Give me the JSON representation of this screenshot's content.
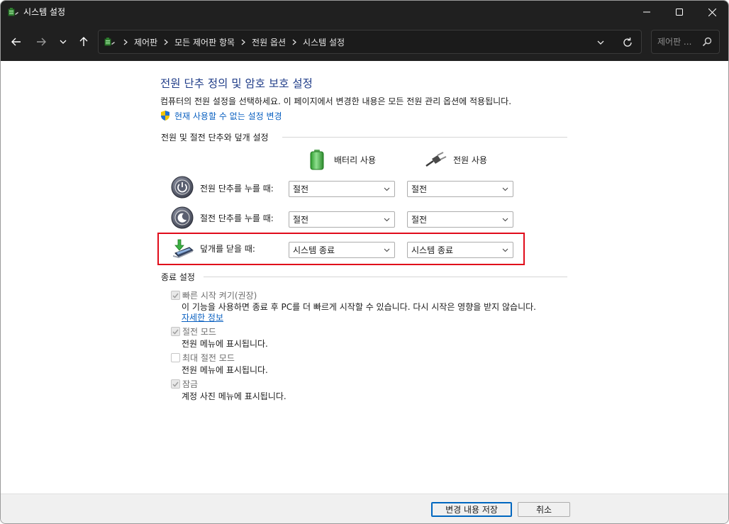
{
  "window": {
    "title": "시스템 설정"
  },
  "address": {
    "breadcrumbs": [
      "제어판",
      "모든 제어판 항목",
      "전원 옵션",
      "시스템 설정"
    ]
  },
  "search": {
    "placeholder": "제어판 ..."
  },
  "page": {
    "title": "전원 단추 정의 및 암호 보호 설정",
    "description": "컴퓨터의 전원 설정을 선택하세요. 이 페이지에서 변경한 내용은 모든 전원 관리 옵션에 적용됩니다.",
    "admin_link": "현재 사용할 수 없는 설정 변경"
  },
  "power_section": {
    "heading": "전원 및 절전 단추와 덮개 설정",
    "col_battery": "배터리 사용",
    "col_plugged": "전원 사용",
    "rows": [
      {
        "label": "전원 단추를 누를 때:",
        "battery": "절전",
        "plugged": "절전"
      },
      {
        "label": "절전 단추를 누를 때:",
        "battery": "절전",
        "plugged": "절전"
      },
      {
        "label": "덮개를 닫을 때:",
        "battery": "시스템 종료",
        "plugged": "시스템 종료"
      }
    ]
  },
  "shutdown_section": {
    "heading": "종료 설정",
    "options": [
      {
        "label": "빠른 시작 켜기(권장)",
        "checked": true,
        "disabled": true,
        "description": "이 기능을 사용하면 종료 후 PC를 더 빠르게 시작할 수 있습니다. 다시 시작은 영향을 받지 않습니다.",
        "link": "자세한 정보"
      },
      {
        "label": "절전 모드",
        "checked": true,
        "disabled": true,
        "description": "전원 메뉴에 표시됩니다."
      },
      {
        "label": "최대 절전 모드",
        "checked": false,
        "disabled": true,
        "description": "전원 메뉴에 표시됩니다."
      },
      {
        "label": "잠금",
        "checked": true,
        "disabled": true,
        "description": "계정 사진 메뉴에 표시됩니다."
      }
    ]
  },
  "footer": {
    "save_label": "변경 내용 저장",
    "cancel_label": "취소"
  },
  "colors": {
    "titlebar": "#202020",
    "title_text": "#1f3c88",
    "link": "#0a60c0",
    "highlight_border": "#e00b1a",
    "primary_button_border": "#0067c0"
  },
  "icons": {
    "app": "power-options-icon",
    "battery": "battery-icon",
    "plug": "power-plug-icon",
    "shield": "uac-shield-icon"
  }
}
